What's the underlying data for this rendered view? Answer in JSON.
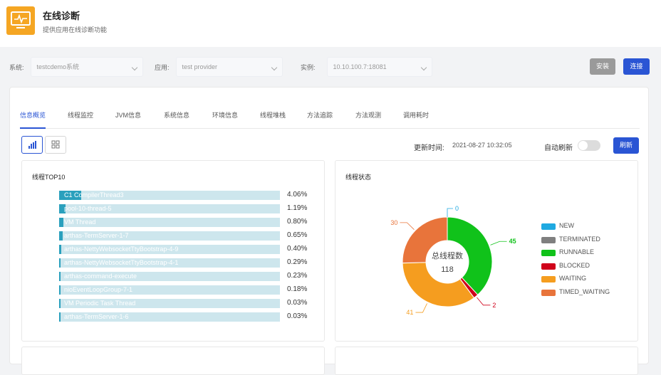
{
  "header": {
    "title": "在线诊断",
    "subtitle": "提供应用在线诊断功能"
  },
  "filters": {
    "system": {
      "label": "系统:",
      "value": "testcdemo系统"
    },
    "app": {
      "label": "应用:",
      "value": "test provider"
    },
    "instance": {
      "label": "实例:",
      "value": "10.10.100.7:18081"
    }
  },
  "buttons": {
    "install": "安装",
    "connect": "连接",
    "refresh": "刷新"
  },
  "tabs": [
    "信息概览",
    "线程监控",
    "JVM信息",
    "系统信息",
    "环境信息",
    "线程堆栈",
    "方法追踪",
    "方法观测",
    "调用耗时"
  ],
  "update": {
    "label": "更新时间:",
    "time": "2021-08-27 10:32:05"
  },
  "auto_refresh": {
    "label": "自动刷新",
    "on": false
  },
  "colors": {
    "primary": "#2a55d4",
    "thread_bar": "#2aa0bd",
    "thread_track": "#cde6ed"
  },
  "thread_top": {
    "title": "线程TOP10",
    "items": [
      {
        "name": "C1 CompilerThread3",
        "pct": "4.06%",
        "value": 4.06
      },
      {
        "name": "pool-10-thread-5",
        "pct": "1.19%",
        "value": 1.19
      },
      {
        "name": "VM Thread",
        "pct": "0.80%",
        "value": 0.8
      },
      {
        "name": "arthas-TermServer-1-7",
        "pct": "0.65%",
        "value": 0.65
      },
      {
        "name": "arthas-NettyWebsocketTtyBootstrap-4-9",
        "pct": "0.40%",
        "value": 0.4
      },
      {
        "name": "arthas-NettyWebsocketTtyBootstrap-4-1",
        "pct": "0.29%",
        "value": 0.29
      },
      {
        "name": "arthas-command-execute",
        "pct": "0.23%",
        "value": 0.23
      },
      {
        "name": "nioEventLoopGroup-7-1",
        "pct": "0.18%",
        "value": 0.18
      },
      {
        "name": "VM Periodic Task Thread",
        "pct": "0.03%",
        "value": 0.03
      },
      {
        "name": "arthas-TermServer-1-6",
        "pct": "0.03%",
        "value": 0.03
      }
    ]
  },
  "thread_state": {
    "title": "线程状态",
    "center_label": "总线程数",
    "total": "118"
  },
  "chart_data": {
    "type": "pie",
    "title": "线程状态",
    "categories": [
      "NEW",
      "TERMINATED",
      "RUNNABLE",
      "BLOCKED",
      "WAITING",
      "TIMED_WAITING"
    ],
    "values": [
      0,
      0,
      45,
      2,
      41,
      30
    ],
    "colors": [
      "#1fa9e1",
      "#7f7f7f",
      "#10c21a",
      "#d0021b",
      "#f59d1f",
      "#e8743b"
    ],
    "total": 118,
    "legend_position": "right"
  }
}
